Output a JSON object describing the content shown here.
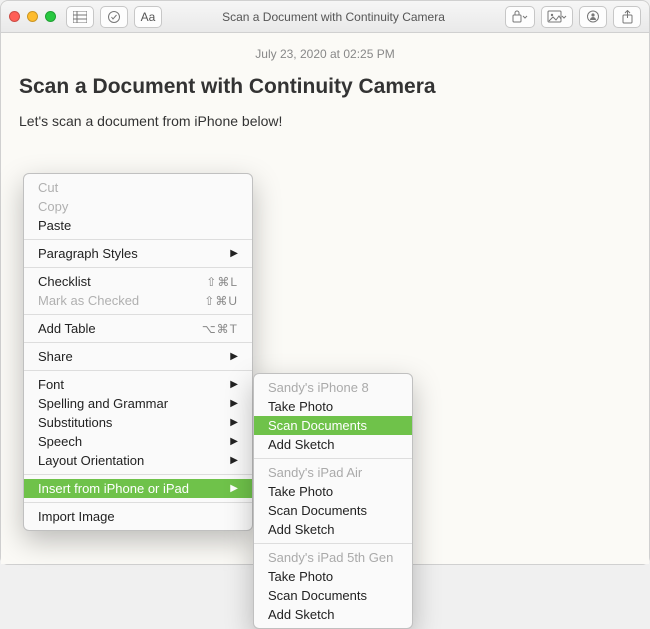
{
  "window": {
    "title": "Scan a Document with Continuity Camera"
  },
  "toolbar": {
    "font_button": "Aa"
  },
  "note": {
    "timestamp": "July 23, 2020 at 02:25 PM",
    "title": "Scan a Document with Continuity Camera",
    "body": "Let's scan a document from iPhone below!"
  },
  "menu": {
    "cut": "Cut",
    "copy": "Copy",
    "paste": "Paste",
    "paragraph_styles": "Paragraph Styles",
    "checklist": {
      "label": "Checklist",
      "shortcut": "⇧⌘L"
    },
    "mark_as_checked": {
      "label": "Mark as Checked",
      "shortcut": "⇧⌘U"
    },
    "add_table": {
      "label": "Add Table",
      "shortcut": "⌥⌘T"
    },
    "share": "Share",
    "font": "Font",
    "spelling_grammar": "Spelling and Grammar",
    "substitutions": "Substitutions",
    "speech": "Speech",
    "layout_orientation": "Layout Orientation",
    "insert_from": "Insert from iPhone or iPad",
    "import_image": "Import Image"
  },
  "submenu": {
    "devices": [
      {
        "name": "Sandy's iPhone 8",
        "actions": [
          "Take Photo",
          "Scan Documents",
          "Add Sketch"
        ],
        "highlight_index": 1
      },
      {
        "name": "Sandy's iPad Air",
        "actions": [
          "Take Photo",
          "Scan Documents",
          "Add Sketch"
        ],
        "highlight_index": -1
      },
      {
        "name": "Sandy's iPad 5th Gen",
        "actions": [
          "Take Photo",
          "Scan Documents",
          "Add Sketch"
        ],
        "highlight_index": -1
      }
    ]
  }
}
